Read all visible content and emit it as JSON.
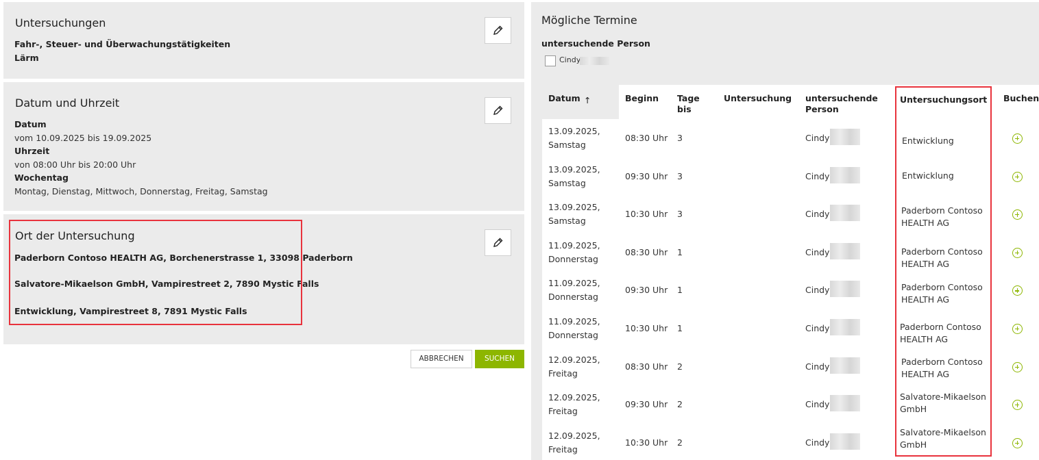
{
  "left": {
    "untersuchungen": {
      "title": "Untersuchungen",
      "items": [
        "Fahr-, Steuer- und Überwachungstätigkeiten",
        "Lärm"
      ]
    },
    "datum": {
      "title": "Datum und Uhrzeit",
      "datum_label": "Datum",
      "datum_value": "vom 10.09.2025 bis 19.09.2025",
      "uhrzeit_label": "Uhrzeit",
      "uhrzeit_value": "von 08:00 Uhr bis 20:00 Uhr",
      "wochentag_label": "Wochentag",
      "wochentag_value": "Montag, Dienstag, Mittwoch, Donnerstag, Freitag, Samstag"
    },
    "ort": {
      "title": "Ort der Untersuchung",
      "items": [
        "Paderborn Contoso HEALTH AG, Borchenerstrasse 1, 33098 Paderborn",
        "Salvatore-Mikaelson GmbH, Vampirestreet 2, 7890 Mystic Falls",
        "Entwicklung, Vampirestreet 8, 7891 Mystic Falls"
      ]
    },
    "buttons": {
      "cancel": "ABBRECHEN",
      "search": "SUCHEN"
    }
  },
  "right": {
    "title": "Mögliche Termine",
    "filter_label": "untersuchende Person",
    "filter_option": "Cindy",
    "columns": {
      "datum": "Datum",
      "sort_arrow": "↑",
      "beginn": "Beginn",
      "tage_l1": "Tage",
      "tage_l2": "bis",
      "untersuchung": "Untersuchung",
      "person_l1": "untersuchende",
      "person_l2": "Person",
      "ort": "Untersuchungsort",
      "buchen": "Buchen"
    },
    "rows": [
      {
        "d1": "13.09.2025,",
        "d2": "Samstag",
        "beginn": "08:30 Uhr",
        "tage": "3",
        "person": "Cindy",
        "o1": "Entwicklung",
        "o2": ""
      },
      {
        "d1": "13.09.2025,",
        "d2": "Samstag",
        "beginn": "09:30 Uhr",
        "tage": "3",
        "person": "Cindy",
        "o1": "Entwicklung",
        "o2": ""
      },
      {
        "d1": "13.09.2025,",
        "d2": "Samstag",
        "beginn": "10:30 Uhr",
        "tage": "3",
        "person": "Cindy",
        "o1": "Paderborn Contoso",
        "o2": "HEALTH AG"
      },
      {
        "d1": "11.09.2025,",
        "d2": "Donnerstag",
        "beginn": "08:30 Uhr",
        "tage": "1",
        "person": "Cindy",
        "o1": "Paderborn Contoso",
        "o2": "HEALTH AG"
      },
      {
        "d1": "11.09.2025,",
        "d2": "Donnerstag",
        "beginn": "09:30 Uhr",
        "tage": "1",
        "person": "Cindy",
        "o1": "Paderborn Contoso",
        "o2": "HEALTH AG"
      },
      {
        "d1": "11.09.2025,",
        "d2": "Donnerstag",
        "beginn": "10:30 Uhr",
        "tage": "1",
        "person": "Cindy",
        "o1": "Paderborn Contoso",
        "o2": "HEALTH AG"
      },
      {
        "d1": "12.09.2025,",
        "d2": "Freitag",
        "beginn": "08:30 Uhr",
        "tage": "2",
        "person": "Cindy",
        "o1": "Paderborn Contoso",
        "o2": "HEALTH AG"
      },
      {
        "d1": "12.09.2025,",
        "d2": "Freitag",
        "beginn": "09:30 Uhr",
        "tage": "2",
        "person": "Cindy",
        "o1": "Salvatore-Mikaelson",
        "o2": "GmbH"
      },
      {
        "d1": "12.09.2025,",
        "d2": "Freitag",
        "beginn": "10:30 Uhr",
        "tage": "2",
        "person": "Cindy",
        "o1": "Salvatore-Mikaelson",
        "o2": "GmbH"
      }
    ]
  },
  "colors": {
    "accent": "#8db600",
    "highlight": "#e8323c",
    "panel_bg": "#ebebeb"
  }
}
